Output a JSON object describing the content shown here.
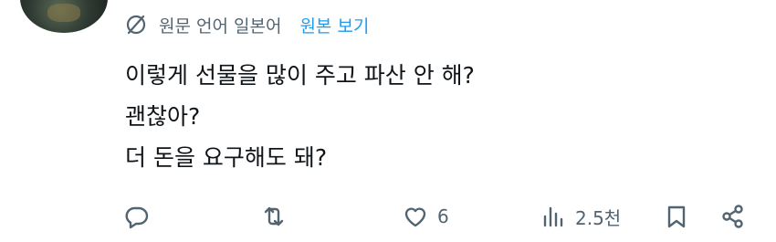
{
  "translation": {
    "label": "원문 언어 일본어",
    "view_original": "원본 보기"
  },
  "tweet": {
    "lines": [
      "이렇게 선물을 많이 주고 파산 안 해?",
      "괜찮아?",
      "더 돈을 요구해도 돼?"
    ]
  },
  "actions": {
    "reply_icon": "speech-bubble",
    "retweet_icon": "retweet-arrows",
    "like_icon": "heart",
    "like_count": "6",
    "views_icon": "bar-chart",
    "views_count": "2.5천",
    "bookmark_icon": "bookmark",
    "share_icon": "share-nodes"
  },
  "colors": {
    "text": "#0f1419",
    "secondary": "#536471",
    "link": "#1d9bf0"
  }
}
